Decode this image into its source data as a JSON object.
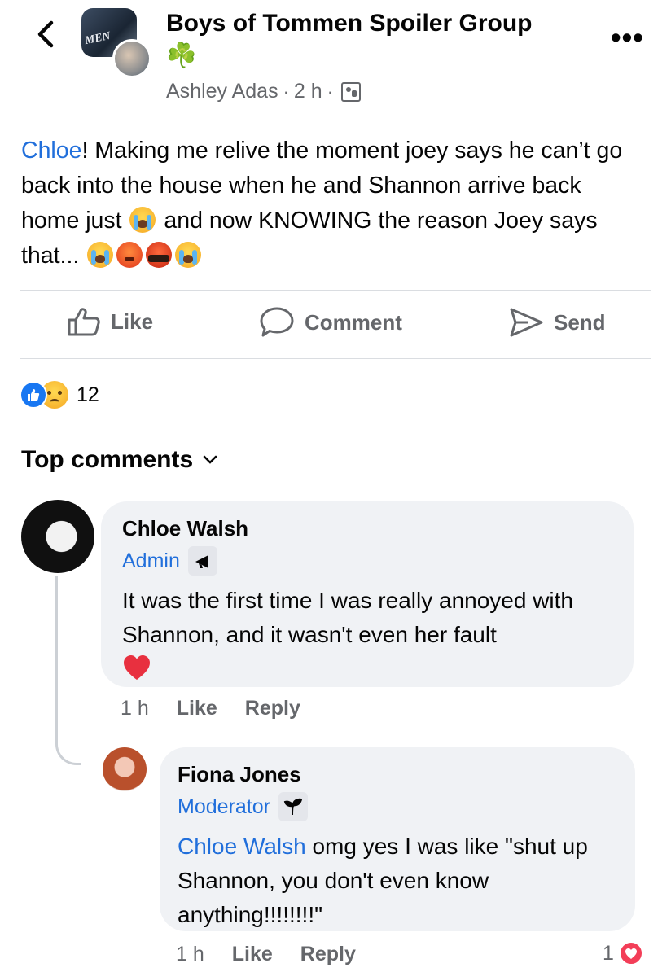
{
  "header": {
    "group_name": "Boys of Tommen Spoiler Group",
    "group_emoji": "☘️",
    "avatar_text": "MEN",
    "author": "Ashley Adas",
    "separator": "·",
    "time": "2 h",
    "more": "•••"
  },
  "post": {
    "mention": "Chloe",
    "text_1": "! Making me relive the moment joey says he can’t go back into the house when he and Shannon arrive back home just ",
    "text_2": " and now KNOWING the reason Joey says that... "
  },
  "actions": {
    "like": "Like",
    "comment": "Comment",
    "send": "Send"
  },
  "reactions": {
    "count": "12"
  },
  "comments_header": {
    "label": "Top comments"
  },
  "comments": [
    {
      "author": "Chloe Walsh",
      "role": "Admin",
      "text": "It was the first time I was really annoyed with Shannon, and it wasn't even her fault",
      "time": "1 h",
      "like": "Like",
      "reply": "Reply"
    },
    {
      "author": "Fiona Jones",
      "role": "Moderator",
      "mention": "Chloe Walsh",
      "text": " omg yes I was like \"shut up Shannon, you don't even know anything!!!!!!!!\"",
      "time": "1 h",
      "like": "Like",
      "reply": "Reply",
      "reaction_count": "1"
    }
  ],
  "colors": {
    "link": "#216fdb",
    "secondary_text": "#65676b",
    "bubble": "#f0f2f5",
    "like_blue": "#1877f2",
    "love_red": "#f33e58"
  },
  "icons": [
    "back-chevron-icon",
    "more-icon",
    "group-privacy-icon",
    "like-icon",
    "comment-icon",
    "send-icon",
    "chevron-down-icon",
    "admin-megaphone-icon",
    "moderator-sprout-icon",
    "heart-icon",
    "love-reaction-icon"
  ]
}
